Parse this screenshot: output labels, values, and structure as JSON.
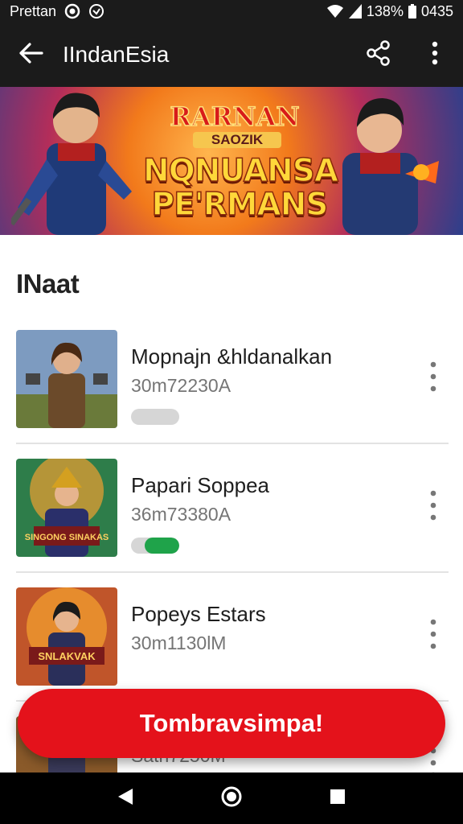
{
  "status_bar": {
    "carrier": "Prettan",
    "battery": "138%",
    "time": "0435"
  },
  "app_bar": {
    "title": "IIndanEsia",
    "icons": [
      "back-arrow-icon",
      "share-icon",
      "more-vert-icon"
    ]
  },
  "banner": {
    "logo_top": "RARNAN",
    "logo_sub": "SAOZIK",
    "logo_main_line1": "NQNUANSA",
    "logo_main_line2": "PE'RMANS",
    "colors": {
      "center": "#ffb54d",
      "edge": "#2c3f8c",
      "title": "#ffd83a"
    }
  },
  "section": {
    "title": "INaat"
  },
  "list": [
    {
      "name": "Mopnajn &hldanalkan",
      "meta": "30m72230A",
      "toggle_level": 0
    },
    {
      "name": "Papari Soppea",
      "meta": "36m73380A",
      "toggle_level": 0.72
    },
    {
      "name": "Popeys Estars",
      "meta": "30m1130lM",
      "toggle_level": null
    },
    {
      "name": "",
      "meta": "Satn7250M",
      "toggle_level": null
    }
  ],
  "thumb_labels": [
    "",
    "SINGONG SINAKAS",
    "SNLAKVAK",
    ""
  ],
  "fab": {
    "label": "Tombravsimpa!",
    "color": "#e4121b"
  },
  "nav_bar": {
    "icons": [
      "back-triangle-icon",
      "home-circle-icon",
      "recents-square-icon"
    ]
  }
}
